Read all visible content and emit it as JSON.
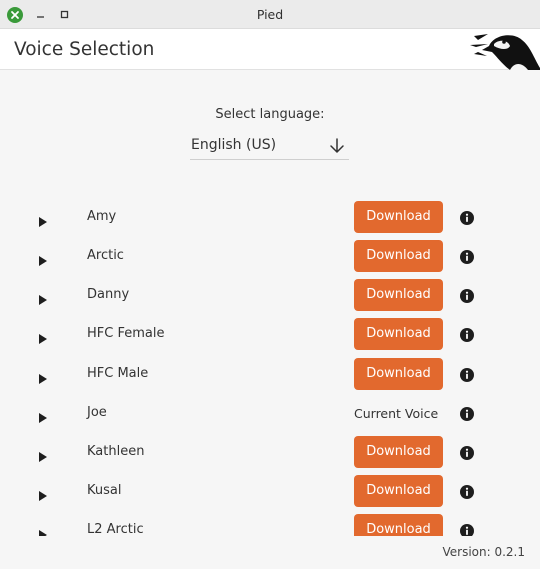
{
  "window": {
    "title": "Pied"
  },
  "header": {
    "title": "Voice Selection"
  },
  "language": {
    "label": "Select language:",
    "selected": "English (US)"
  },
  "download_label": "Download",
  "voices": [
    {
      "name": "Amy",
      "action": "download"
    },
    {
      "name": "Arctic",
      "action": "download"
    },
    {
      "name": "Danny",
      "action": "download"
    },
    {
      "name": "HFC Female",
      "action": "download"
    },
    {
      "name": "HFC Male",
      "action": "download"
    },
    {
      "name": "Joe",
      "action": "status",
      "status": "Current Voice"
    },
    {
      "name": "Kathleen",
      "action": "download"
    },
    {
      "name": "Kusal",
      "action": "download"
    },
    {
      "name": "L2 Arctic",
      "action": "download"
    }
  ],
  "footer": {
    "version": "Version: 0.2.1"
  },
  "colors": {
    "accent": "#e2692e",
    "close": "#3a9a3a"
  }
}
